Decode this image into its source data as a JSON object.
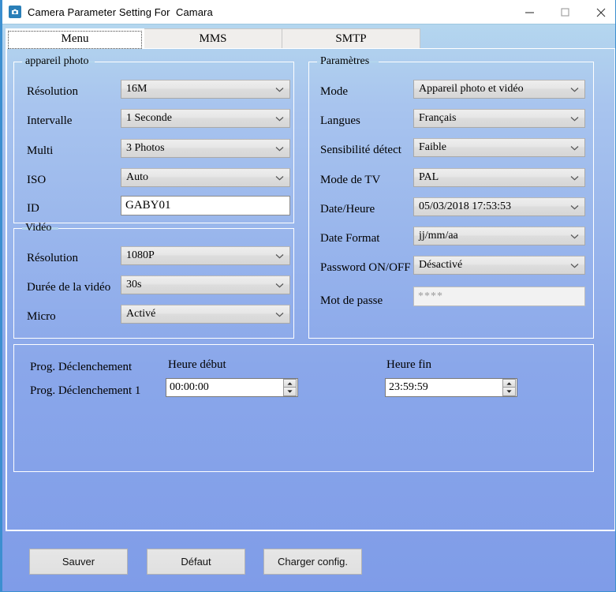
{
  "window": {
    "title": "Camera Parameter Setting For  Camara",
    "app_icon": "camera-app-icon",
    "minimize_label": "–",
    "maximize_label": "□",
    "close_label": "✕"
  },
  "tabs": [
    {
      "label": "Menu",
      "selected": true
    },
    {
      "label": "MMS",
      "selected": false
    },
    {
      "label": "SMTP",
      "selected": false
    }
  ],
  "groups": {
    "camera": {
      "title": "appareil photo",
      "fields": [
        {
          "label": "Résolution",
          "value": "16M",
          "type": "combo"
        },
        {
          "label": "Intervalle",
          "value": "1 Seconde",
          "type": "combo"
        },
        {
          "label": "Multi",
          "value": "3 Photos",
          "type": "combo"
        },
        {
          "label": "ISO",
          "value": "Auto",
          "type": "combo"
        },
        {
          "label": "ID",
          "value": "GABY01",
          "type": "text"
        }
      ]
    },
    "video": {
      "title": "Vidéo",
      "fields": [
        {
          "label": "Résolution",
          "value": "1080P",
          "type": "combo"
        },
        {
          "label": "Durée de la vidéo",
          "value": "30s",
          "type": "combo"
        },
        {
          "label": "Micro",
          "value": "Activé",
          "type": "combo"
        }
      ]
    },
    "params": {
      "title": "Paramètres",
      "fields": [
        {
          "label": "Mode",
          "value": "Appareil photo et vidéo",
          "type": "combo"
        },
        {
          "label": "Langues",
          "value": "Français",
          "type": "combo"
        },
        {
          "label": "Sensibilité détect",
          "value": "Faible",
          "type": "combo"
        },
        {
          "label": "Mode de TV",
          "value": "PAL",
          "type": "combo"
        },
        {
          "label": "Date/Heure",
          "value": "05/03/2018 17:53:53",
          "type": "combo"
        },
        {
          "label": "Date Format",
          "value": "jj/mm/aa",
          "type": "combo"
        },
        {
          "label": "Password ON/OFF",
          "value": "Désactivé",
          "type": "combo"
        },
        {
          "label": "Mot de passe",
          "value": "",
          "placeholder": "****",
          "type": "password"
        }
      ]
    },
    "schedule": {
      "title": "",
      "row_header_label": "Prog. Déclenchement",
      "row_label": "Prog. Déclenchement 1",
      "col_start_label": "Heure début",
      "col_end_label": "Heure fin",
      "start_value": "00:00:00",
      "end_value": "23:59:59"
    }
  },
  "buttons": {
    "save": "Sauver",
    "default": "Défaut",
    "load": "Charger config."
  },
  "colors": {
    "window_top": "#b8dcef",
    "window_bottom": "#7f9ce8",
    "frame_border": "#3c8fd0",
    "titlebar_bg": "#ffffff",
    "group_border": "#ffffff",
    "combo_bg": "#e4e4e4",
    "textbox_bg": "#ffffff",
    "button_bg": "#e2e2e2",
    "app_icon_bg": "#2a7fb8"
  }
}
